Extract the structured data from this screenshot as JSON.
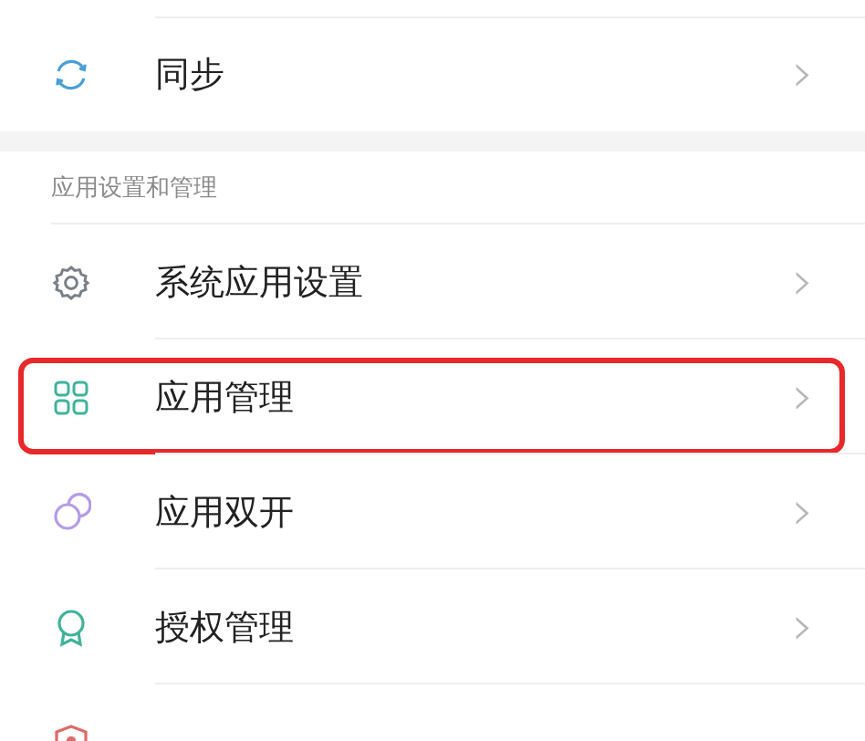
{
  "top_items": [
    {
      "label": "同步",
      "chevron": "›"
    }
  ],
  "section": {
    "header": "应用设置和管理",
    "items": [
      {
        "label": "系统应用设置",
        "chevron": "›",
        "highlighted": false
      },
      {
        "label": "应用管理",
        "chevron": "›",
        "highlighted": true
      },
      {
        "label": "应用双开",
        "chevron": "›",
        "highlighted": false
      },
      {
        "label": "授权管理",
        "chevron": "›",
        "highlighted": false
      },
      {
        "highlighted": false
      }
    ]
  }
}
